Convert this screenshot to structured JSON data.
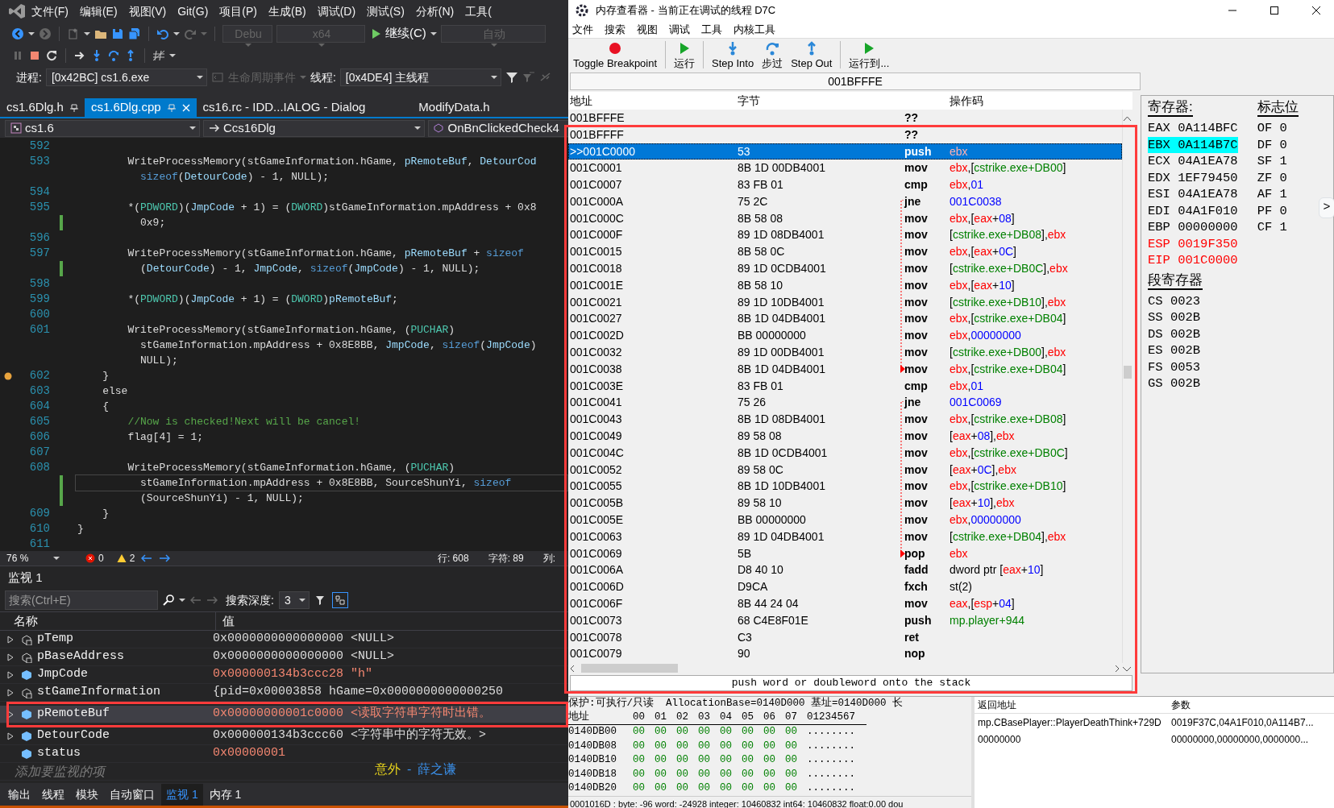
{
  "vs": {
    "menu": [
      "文件(F)",
      "编辑(E)",
      "视图(V)",
      "Git(G)",
      "项目(P)",
      "生成(B)",
      "调试(D)",
      "测试(S)",
      "分析(N)",
      "工具("
    ],
    "toolbar": {
      "config": "Debu",
      "platform": "x64",
      "continue": "继续(C)",
      "target": "自动"
    },
    "process_bar": {
      "process_label": "进程:",
      "process": "[0x42BC] cs1.6.exe",
      "lifecycle": "生命周期事件",
      "thread_label": "线程:",
      "thread": "[0x4DE4] 主线程"
    },
    "tabs": [
      {
        "label": "cs1.6Dlg.h",
        "selected": false,
        "pinned": true
      },
      {
        "label": "cs1.6Dlg.cpp",
        "selected": true,
        "pinned": true
      },
      {
        "label": "cs16.rc - IDD...IALOG - Dialog",
        "selected": false,
        "pinned": false
      },
      {
        "label": "ModifyData.h",
        "selected": false,
        "pinned": false
      }
    ],
    "nav": {
      "project": "cs1.6",
      "class": "Ccs16Dlg",
      "member": "OnBnClickedCheck4"
    },
    "code": [
      {
        "n": "592"
      },
      {
        "n": "593",
        "segs": [
          {
            "text": "        WriteProcessMemory(stGameInformation.hGame, ",
            "kind": "plain"
          },
          {
            "text": "pRemoteBuf",
            "kind": "var"
          },
          {
            "text": ", ",
            "kind": "plain"
          },
          {
            "text": "DetourCod",
            "kind": "var"
          }
        ]
      },
      {
        "segs": [
          {
            "text": "          sizeof",
            "kind": "keyword"
          },
          {
            "text": "(",
            "kind": "plain"
          },
          {
            "text": "DetourCode",
            "kind": "var"
          },
          {
            "text": ") - 1, NULL);",
            "kind": "plain"
          }
        ]
      },
      {
        "n": "594"
      },
      {
        "n": "595",
        "segs": [
          {
            "text": "        *(",
            "kind": "plain"
          },
          {
            "text": "PDWORD",
            "kind": "type"
          },
          {
            "text": ")(",
            "kind": "plain"
          },
          {
            "text": "JmpCode",
            "kind": "var"
          },
          {
            "text": " + 1) = (",
            "kind": "plain"
          },
          {
            "text": "DWORD",
            "kind": "type"
          },
          {
            "text": ")stGameInformation.mpAddress + 0x8",
            "kind": "plain"
          }
        ]
      },
      {
        "changed": true,
        "segs": [
          {
            "text": "          0x9;",
            "kind": "plain"
          }
        ]
      },
      {
        "n": "596"
      },
      {
        "n": "597",
        "segs": [
          {
            "text": "        WriteProcessMemory(stGameInformation.hGame, ",
            "kind": "plain"
          },
          {
            "text": "pRemoteBuf",
            "kind": "var"
          },
          {
            "text": " + ",
            "kind": "plain"
          },
          {
            "text": "sizeof",
            "kind": "keyword"
          }
        ]
      },
      {
        "changed": true,
        "segs": [
          {
            "text": "          (",
            "kind": "plain"
          },
          {
            "text": "DetourCode",
            "kind": "var"
          },
          {
            "text": ") - 1, ",
            "kind": "plain"
          },
          {
            "text": "JmpCode",
            "kind": "var"
          },
          {
            "text": ", ",
            "kind": "plain"
          },
          {
            "text": "sizeof",
            "kind": "keyword"
          },
          {
            "text": "(",
            "kind": "plain"
          },
          {
            "text": "JmpCode",
            "kind": "var"
          },
          {
            "text": ") - 1, NULL);",
            "kind": "plain"
          }
        ]
      },
      {
        "n": "598"
      },
      {
        "n": "599",
        "segs": [
          {
            "text": "        *(",
            "kind": "plain"
          },
          {
            "text": "PDWORD",
            "kind": "type"
          },
          {
            "text": ")(",
            "kind": "plain"
          },
          {
            "text": "JmpCode",
            "kind": "var"
          },
          {
            "text": " + 1) = (",
            "kind": "plain"
          },
          {
            "text": "DWORD",
            "kind": "type"
          },
          {
            "text": ")",
            "kind": "plain"
          },
          {
            "text": "pRemoteBuf",
            "kind": "var"
          },
          {
            "text": ";",
            "kind": "plain"
          }
        ]
      },
      {
        "n": "600"
      },
      {
        "n": "601",
        "segs": [
          {
            "text": "        WriteProcessMemory(stGameInformation.hGame, (",
            "kind": "plain"
          },
          {
            "text": "PUCHAR",
            "kind": "type"
          },
          {
            "text": ")",
            "kind": "plain"
          }
        ]
      },
      {
        "segs": [
          {
            "text": "          stGameInformation.mpAddress + 0x8E8BB, ",
            "kind": "plain"
          },
          {
            "text": "JmpCode",
            "kind": "var"
          },
          {
            "text": ", ",
            "kind": "plain"
          },
          {
            "text": "sizeof",
            "kind": "keyword"
          },
          {
            "text": "(",
            "kind": "plain"
          },
          {
            "text": "JmpCode",
            "kind": "var"
          },
          {
            "text": ")",
            "kind": "plain"
          }
        ]
      },
      {
        "segs": [
          {
            "text": "          NULL);",
            "kind": "plain"
          }
        ]
      },
      {
        "n": "602",
        "bp": true,
        "segs": [
          {
            "text": "    }",
            "kind": "plain"
          }
        ]
      },
      {
        "n": "603",
        "segs": [
          {
            "text": "    else",
            "kind": "plain"
          }
        ]
      },
      {
        "n": "604",
        "segs": [
          {
            "text": "    {",
            "kind": "plain"
          }
        ]
      },
      {
        "n": "605",
        "segs": [
          {
            "text": "        //Now is checked!Next will be cancel!",
            "kind": "comment"
          }
        ]
      },
      {
        "n": "606",
        "segs": [
          {
            "text": "        flag[4] = 1;",
            "kind": "plain"
          }
        ]
      },
      {
        "n": "607"
      },
      {
        "n": "608",
        "segs": [
          {
            "text": "        WriteProcessMemory(stGameInformation.hGame, (",
            "kind": "plain"
          },
          {
            "text": "PUCHAR",
            "kind": "type"
          },
          {
            "text": ")",
            "kind": "plain"
          }
        ]
      },
      {
        "changed": true,
        "current": true,
        "segs": [
          {
            "text": "          stGameInformation.mpAddress + 0x8E8BB, SourceShunYi, ",
            "kind": "plain"
          },
          {
            "text": "sizeof",
            "kind": "keyword"
          }
        ]
      },
      {
        "changed": true,
        "segs": [
          {
            "text": "          (SourceShunYi) - 1, NULL);",
            "kind": "plain"
          }
        ]
      },
      {
        "n": "609",
        "segs": [
          {
            "text": "    }",
            "kind": "plain"
          }
        ]
      },
      {
        "n": "610",
        "segs": [
          {
            "text": "}",
            "kind": "plain"
          }
        ]
      },
      {
        "n": "611"
      }
    ],
    "editor_status": {
      "zoom": "76 %",
      "errors": "0",
      "warnings": "2",
      "line": "行: 608",
      "char": "字符: 89",
      "col": "列:"
    },
    "watch": {
      "title": "监视 1",
      "search_placeholder": "搜索(Ctrl+E)",
      "depth_label": "搜索深度:",
      "depth": "3",
      "hex_toggle_on": true,
      "columns": [
        "名称",
        "值"
      ],
      "rows": [
        {
          "name": "pTemp",
          "value": "0x0000000000000000 <NULL>",
          "kind": "member",
          "expandable": true,
          "changed": false,
          "selected": false
        },
        {
          "name": "pBaseAddress",
          "value": "0x0000000000000000 <NULL>",
          "kind": "member",
          "expandable": true,
          "changed": false,
          "selected": false
        },
        {
          "name": "JmpCode",
          "value": "0x000000134b3ccc28 \"h\"",
          "kind": "variable",
          "expandable": true,
          "changed": true,
          "selected": false
        },
        {
          "name": "stGameInformation",
          "value": "{pid=0x00003858 hGame=0x0000000000000250",
          "kind": "member",
          "expandable": true,
          "changed": false,
          "selected": false
        },
        {
          "name": "pRemoteBuf",
          "value": "0x00000000001c0000 <读取字符串字符时出错。",
          "kind": "variable",
          "expandable": true,
          "changed": true,
          "selected": true
        },
        {
          "name": "DetourCode",
          "value": "0x000000134b3ccc60  <字符串中的字符无效。>",
          "kind": "variable",
          "expandable": true,
          "changed": false,
          "selected": false
        },
        {
          "name": "status",
          "value": "0x00000001",
          "kind": "variable",
          "expandable": false,
          "changed": true,
          "selected": false
        }
      ],
      "add_placeholder": "添加要监视的项"
    },
    "bottom_tabs": [
      {
        "label": "输出",
        "selected": false
      },
      {
        "label": "线程",
        "selected": false
      },
      {
        "label": "模块",
        "selected": false
      },
      {
        "label": "自动窗口",
        "selected": false
      },
      {
        "label": "监视 1",
        "selected": true
      },
      {
        "label": "内存 1",
        "selected": false
      }
    ]
  },
  "lyrics": {
    "title": "意外",
    "separator": "-",
    "artist": "薛之谦"
  },
  "ce": {
    "title": "内存查看器 - 当前正在调试的线程 D7C",
    "menu": [
      "文件",
      "搜索",
      "视图",
      "调试",
      "工具",
      "内核工具"
    ],
    "tools": [
      {
        "label": "Toggle Breakpoint",
        "kind": "breakpoint"
      },
      {
        "label": "运行",
        "kind": "run"
      },
      {
        "label": "Step Into",
        "kind": "step-into"
      },
      {
        "label": "步过",
        "kind": "step-over"
      },
      {
        "label": "Step Out",
        "kind": "step-out"
      },
      {
        "label": "运行到...",
        "kind": "run-to"
      }
    ],
    "address_bar": "001BFFFE",
    "columns": [
      "地址",
      "字节",
      "操作码"
    ],
    "rows": [
      {
        "address": "001BFFFE",
        "op": "??",
        "selected": false
      },
      {
        "address": "001BFFFF",
        "op": "??",
        "selected": false
      },
      {
        "address": ">>001C0000",
        "bytes": "53",
        "op": "push",
        "args": [
          {
            "text": "ebx",
            "kind": "reg"
          }
        ],
        "selected": true
      },
      {
        "address": "001C0001",
        "bytes": "8B 1D 00DB4001",
        "op": "mov",
        "args": [
          {
            "text": "ebx",
            "kind": "reg"
          },
          {
            "text": ",[",
            "kind": "plain"
          },
          {
            "text": "cstrike.exe+DB00",
            "kind": "sym"
          },
          {
            "text": "]",
            "kind": "plain"
          }
        ],
        "selected": false
      },
      {
        "address": "001C0007",
        "bytes": "83 FB 01",
        "op": "cmp",
        "args": [
          {
            "text": "ebx",
            "kind": "reg"
          },
          {
            "text": ",",
            "kind": "plain"
          },
          {
            "text": "01",
            "kind": "num"
          }
        ],
        "selected": false
      },
      {
        "address": "001C000A",
        "bytes": "75 2C",
        "op": "jne",
        "args": [
          {
            "text": "001C0038",
            "kind": "num"
          }
        ],
        "selected": false,
        "jump_start": true
      },
      {
        "address": "001C000C",
        "bytes": "8B 58 08",
        "op": "mov",
        "args": [
          {
            "text": "ebx",
            "kind": "reg"
          },
          {
            "text": ",[",
            "kind": "plain"
          },
          {
            "text": "eax",
            "kind": "reg"
          },
          {
            "text": "+",
            "kind": "plain"
          },
          {
            "text": "08",
            "kind": "num"
          },
          {
            "text": "]",
            "kind": "plain"
          }
        ],
        "selected": false
      },
      {
        "address": "001C000F",
        "bytes": "89 1D 08DB4001",
        "op": "mov",
        "args": [
          {
            "text": "[",
            "kind": "plain"
          },
          {
            "text": "cstrike.exe+DB08",
            "kind": "sym"
          },
          {
            "text": "],",
            "kind": "plain"
          },
          {
            "text": "ebx",
            "kind": "reg"
          }
        ],
        "selected": false
      },
      {
        "address": "001C0015",
        "bytes": "8B 58 0C",
        "op": "mov",
        "args": [
          {
            "text": "ebx",
            "kind": "reg"
          },
          {
            "text": ",[",
            "kind": "plain"
          },
          {
            "text": "eax",
            "kind": "reg"
          },
          {
            "text": "+",
            "kind": "plain"
          },
          {
            "text": "0C",
            "kind": "num"
          },
          {
            "text": "]",
            "kind": "plain"
          }
        ],
        "selected": false
      },
      {
        "address": "001C0018",
        "bytes": "89 1D 0CDB4001",
        "op": "mov",
        "args": [
          {
            "text": "[",
            "kind": "plain"
          },
          {
            "text": "cstrike.exe+DB0C",
            "kind": "sym"
          },
          {
            "text": "],",
            "kind": "plain"
          },
          {
            "text": "ebx",
            "kind": "reg"
          }
        ],
        "selected": false
      },
      {
        "address": "001C001E",
        "bytes": "8B 58 10",
        "op": "mov",
        "args": [
          {
            "text": "ebx",
            "kind": "reg"
          },
          {
            "text": ",[",
            "kind": "plain"
          },
          {
            "text": "eax",
            "kind": "reg"
          },
          {
            "text": "+",
            "kind": "plain"
          },
          {
            "text": "10",
            "kind": "num"
          },
          {
            "text": "]",
            "kind": "plain"
          }
        ],
        "selected": false
      },
      {
        "address": "001C0021",
        "bytes": "89 1D 10DB4001",
        "op": "mov",
        "args": [
          {
            "text": "[",
            "kind": "plain"
          },
          {
            "text": "cstrike.exe+DB10",
            "kind": "sym"
          },
          {
            "text": "],",
            "kind": "plain"
          },
          {
            "text": "ebx",
            "kind": "reg"
          }
        ],
        "selected": false
      },
      {
        "address": "001C0027",
        "bytes": "8B 1D 04DB4001",
        "op": "mov",
        "args": [
          {
            "text": "ebx",
            "kind": "reg"
          },
          {
            "text": ",[",
            "kind": "plain"
          },
          {
            "text": "cstrike.exe+DB04",
            "kind": "sym"
          },
          {
            "text": "]",
            "kind": "plain"
          }
        ],
        "selected": false
      },
      {
        "address": "001C002D",
        "bytes": "BB 00000000",
        "op": "mov",
        "args": [
          {
            "text": "ebx",
            "kind": "reg"
          },
          {
            "text": ",",
            "kind": "plain"
          },
          {
            "text": "00000000",
            "kind": "num"
          }
        ],
        "selected": false
      },
      {
        "address": "001C0032",
        "bytes": "89 1D 00DB4001",
        "op": "mov",
        "args": [
          {
            "text": "[",
            "kind": "plain"
          },
          {
            "text": "cstrike.exe+DB00",
            "kind": "sym"
          },
          {
            "text": "],",
            "kind": "plain"
          },
          {
            "text": "ebx",
            "kind": "reg"
          }
        ],
        "selected": false
      },
      {
        "address": "001C0038",
        "bytes": "8B 1D 04DB4001",
        "op": "mov",
        "args": [
          {
            "text": "ebx",
            "kind": "reg"
          },
          {
            "text": ",[",
            "kind": "plain"
          },
          {
            "text": "cstrike.exe+DB04",
            "kind": "sym"
          },
          {
            "text": "]",
            "kind": "plain"
          }
        ],
        "selected": false,
        "jump_target": true
      },
      {
        "address": "001C003E",
        "bytes": "83 FB 01",
        "op": "cmp",
        "args": [
          {
            "text": "ebx",
            "kind": "reg"
          },
          {
            "text": ",",
            "kind": "plain"
          },
          {
            "text": "01",
            "kind": "num"
          }
        ],
        "selected": false
      },
      {
        "address": "001C0041",
        "bytes": "75 26",
        "op": "jne",
        "args": [
          {
            "text": "001C0069",
            "kind": "num"
          }
        ],
        "selected": false,
        "jump_start": true
      },
      {
        "address": "001C0043",
        "bytes": "8B 1D 08DB4001",
        "op": "mov",
        "args": [
          {
            "text": "ebx",
            "kind": "reg"
          },
          {
            "text": ",[",
            "kind": "plain"
          },
          {
            "text": "cstrike.exe+DB08",
            "kind": "sym"
          },
          {
            "text": "]",
            "kind": "plain"
          }
        ],
        "selected": false
      },
      {
        "address": "001C0049",
        "bytes": "89 58 08",
        "op": "mov",
        "args": [
          {
            "text": "[",
            "kind": "plain"
          },
          {
            "text": "eax",
            "kind": "reg"
          },
          {
            "text": "+",
            "kind": "plain"
          },
          {
            "text": "08",
            "kind": "num"
          },
          {
            "text": "],",
            "kind": "plain"
          },
          {
            "text": "ebx",
            "kind": "reg"
          }
        ],
        "selected": false
      },
      {
        "address": "001C004C",
        "bytes": "8B 1D 0CDB4001",
        "op": "mov",
        "args": [
          {
            "text": "ebx",
            "kind": "reg"
          },
          {
            "text": ",[",
            "kind": "plain"
          },
          {
            "text": "cstrike.exe+DB0C",
            "kind": "sym"
          },
          {
            "text": "]",
            "kind": "plain"
          }
        ],
        "selected": false
      },
      {
        "address": "001C0052",
        "bytes": "89 58 0C",
        "op": "mov",
        "args": [
          {
            "text": "[",
            "kind": "plain"
          },
          {
            "text": "eax",
            "kind": "reg"
          },
          {
            "text": "+",
            "kind": "plain"
          },
          {
            "text": "0C",
            "kind": "num"
          },
          {
            "text": "],",
            "kind": "plain"
          },
          {
            "text": "ebx",
            "kind": "reg"
          }
        ],
        "selected": false
      },
      {
        "address": "001C0055",
        "bytes": "8B 1D 10DB4001",
        "op": "mov",
        "args": [
          {
            "text": "ebx",
            "kind": "reg"
          },
          {
            "text": ",[",
            "kind": "plain"
          },
          {
            "text": "cstrike.exe+DB10",
            "kind": "sym"
          },
          {
            "text": "]",
            "kind": "plain"
          }
        ],
        "selected": false
      },
      {
        "address": "001C005B",
        "bytes": "89 58 10",
        "op": "mov",
        "args": [
          {
            "text": "[",
            "kind": "plain"
          },
          {
            "text": "eax",
            "kind": "reg"
          },
          {
            "text": "+",
            "kind": "plain"
          },
          {
            "text": "10",
            "kind": "num"
          },
          {
            "text": "],",
            "kind": "plain"
          },
          {
            "text": "ebx",
            "kind": "reg"
          }
        ],
        "selected": false
      },
      {
        "address": "001C005E",
        "bytes": "BB 00000000",
        "op": "mov",
        "args": [
          {
            "text": "ebx",
            "kind": "reg"
          },
          {
            "text": ",",
            "kind": "plain"
          },
          {
            "text": "00000000",
            "kind": "num"
          }
        ],
        "selected": false
      },
      {
        "address": "001C0063",
        "bytes": "89 1D 04DB4001",
        "op": "mov",
        "args": [
          {
            "text": "[",
            "kind": "plain"
          },
          {
            "text": "cstrike.exe+DB04",
            "kind": "sym"
          },
          {
            "text": "],",
            "kind": "plain"
          },
          {
            "text": "ebx",
            "kind": "reg"
          }
        ],
        "selected": false
      },
      {
        "address": "001C0069",
        "bytes": "5B",
        "op": "pop",
        "args": [
          {
            "text": "ebx",
            "kind": "reg"
          }
        ],
        "selected": false,
        "jump_target": true
      },
      {
        "address": "001C006A",
        "bytes": "D8 40 10",
        "op": "fadd",
        "args": [
          {
            "text": "dword ptr [",
            "kind": "plain"
          },
          {
            "text": "eax",
            "kind": "reg"
          },
          {
            "text": "+",
            "kind": "plain"
          },
          {
            "text": "10",
            "kind": "num"
          },
          {
            "text": "]",
            "kind": "plain"
          }
        ],
        "selected": false
      },
      {
        "address": "001C006D",
        "bytes": "D9CA",
        "op": "fxch",
        "args": [
          {
            "text": "st(2)",
            "kind": "plain"
          }
        ],
        "selected": false
      },
      {
        "address": "001C006F",
        "bytes": "8B 44 24 04",
        "op": "mov",
        "args": [
          {
            "text": "eax",
            "kind": "reg"
          },
          {
            "text": ",[",
            "kind": "plain"
          },
          {
            "text": "esp",
            "kind": "reg"
          },
          {
            "text": "+",
            "kind": "plain"
          },
          {
            "text": "04",
            "kind": "num"
          },
          {
            "text": "]",
            "kind": "plain"
          }
        ],
        "selected": false
      },
      {
        "address": "001C0073",
        "bytes": "68 C4E8F01E",
        "op": "push",
        "args": [
          {
            "text": "mp.player+944",
            "kind": "sym"
          }
        ],
        "selected": false
      },
      {
        "address": "001C0078",
        "bytes": "C3",
        "op": "ret",
        "selected": false
      },
      {
        "address": "001C0079",
        "bytes": "90",
        "op": "nop",
        "selected": false
      }
    ],
    "description": "push word or doubleword onto the stack",
    "registers": {
      "title": "寄存器:",
      "items": [
        {
          "name": "EAX",
          "value": "0A114BFC",
          "selected": false,
          "changed": false
        },
        {
          "name": "EBX",
          "value": "0A114B7C",
          "selected": true,
          "changed": false
        },
        {
          "name": "ECX",
          "value": "04A1EA78",
          "selected": false,
          "changed": false
        },
        {
          "name": "EDX",
          "value": "1EF79450",
          "selected": false,
          "changed": false
        },
        {
          "name": "ESI",
          "value": "04A1EA78",
          "selected": false,
          "changed": false
        },
        {
          "name": "EDI",
          "value": "04A1F010",
          "selected": false,
          "changed": false
        },
        {
          "name": "EBP",
          "value": "00000000",
          "selected": false,
          "changed": false
        },
        {
          "name": "ESP",
          "value": "0019F350",
          "selected": false,
          "changed": true
        },
        {
          "name": "EIP",
          "value": "001C0000",
          "selected": false,
          "changed": true
        }
      ]
    },
    "flags": {
      "title": "标志位",
      "items": [
        {
          "name": "OF",
          "value": "0"
        },
        {
          "name": "DF",
          "value": "0"
        },
        {
          "name": "SF",
          "value": "1"
        },
        {
          "name": "ZF",
          "value": "0"
        },
        {
          "name": "AF",
          "value": "1"
        },
        {
          "name": "PF",
          "value": "0"
        },
        {
          "name": "CF",
          "value": "1"
        }
      ]
    },
    "segments": {
      "title": "段寄存器",
      "items": [
        {
          "name": "CS",
          "value": "0023"
        },
        {
          "name": "SS",
          "value": "002B"
        },
        {
          "name": "DS",
          "value": "002B"
        },
        {
          "name": "ES",
          "value": "002B"
        },
        {
          "name": "FS",
          "value": "0053"
        },
        {
          "name": "GS",
          "value": "002B"
        }
      ]
    },
    "expand": ">",
    "hex": {
      "info": "保护:可执行/只读  AllocationBase=0140D000 基址=0140D000 长",
      "header_label": "地址",
      "header_bytes": [
        "00",
        "01",
        "02",
        "03",
        "04",
        "05",
        "06",
        "07"
      ],
      "header_ascii": "01234567",
      "rows": [
        {
          "address": "0140DB00",
          "bytes": [
            "00",
            "00",
            "00",
            "00",
            "00",
            "00",
            "00",
            "00"
          ],
          "ascii": "........"
        },
        {
          "address": "0140DB08",
          "bytes": [
            "00",
            "00",
            "00",
            "00",
            "00",
            "00",
            "00",
            "00"
          ],
          "ascii": "........"
        },
        {
          "address": "0140DB10",
          "bytes": [
            "00",
            "00",
            "00",
            "00",
            "00",
            "00",
            "00",
            "00"
          ],
          "ascii": "........"
        },
        {
          "address": "0140DB18",
          "bytes": [
            "00",
            "00",
            "00",
            "00",
            "00",
            "00",
            "00",
            "00"
          ],
          "ascii": "........"
        },
        {
          "address": "0140DB20",
          "bytes": [
            "00",
            "00",
            "00",
            "00",
            "00",
            "00",
            "00",
            "00"
          ],
          "ascii": "........"
        }
      ]
    },
    "stack": {
      "columns": [
        "返回地址",
        "参数"
      ],
      "rows": [
        {
          "return": "mp.CBasePlayer::PlayerDeathThink+729D",
          "params": "0019F37C,04A1F010,0A114B7..."
        },
        {
          "return": "00000000",
          "params": "00000000,00000000,0000000..."
        }
      ]
    },
    "status": "0001016D : byte: -96 word: -24928 integer: 10460832 int64: 10460832 float:0.00 dou"
  }
}
